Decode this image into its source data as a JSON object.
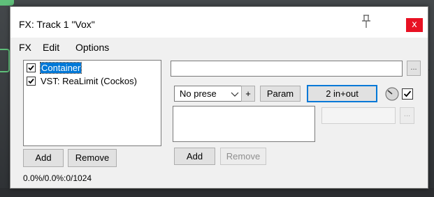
{
  "window": {
    "title": "FX: Track 1 \"Vox\"",
    "close_label": "x"
  },
  "menu": [
    "FX",
    "Edit",
    "Options"
  ],
  "fx_chain": [
    {
      "label": "Container",
      "checked": true,
      "selected": true
    },
    {
      "label": "VST: ReaLimit (Cockos)",
      "checked": true,
      "selected": false
    }
  ],
  "left_buttons": {
    "add": "Add",
    "remove": "Remove"
  },
  "cpu_status": "0.0%/0.0%:0/1024",
  "right_panel": {
    "dots_label": "...",
    "preset_value": "No prese",
    "plus_label": "+",
    "param_label": "Param",
    "io_label": "2 in+out",
    "add": "Add",
    "remove": "Remove"
  },
  "colors": {
    "accent": "#0078d7",
    "close_red": "#e81123",
    "track_green": "#5fbf7a"
  }
}
